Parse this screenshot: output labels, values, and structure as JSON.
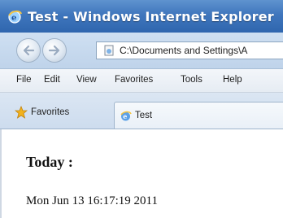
{
  "window": {
    "title": "Test - Windows Internet Explorer"
  },
  "navbar": {
    "address": "C:\\Documents and Settings\\A",
    "back_icon": "back-arrow-icon",
    "forward_icon": "forward-arrow-icon"
  },
  "menu": {
    "items": [
      "File",
      "Edit",
      "View",
      "Favorites",
      "Tools",
      "Help"
    ]
  },
  "favorites_bar": {
    "favorites_label": "Favorites",
    "tab_label": "Test"
  },
  "content": {
    "heading": "Today :",
    "datetime": "Mon Jun 13 16:17:19 2011"
  },
  "colors": {
    "titlebar": "#3f76bd",
    "chrome": "#cfe0f2",
    "accent_star": "#f2b21c"
  }
}
